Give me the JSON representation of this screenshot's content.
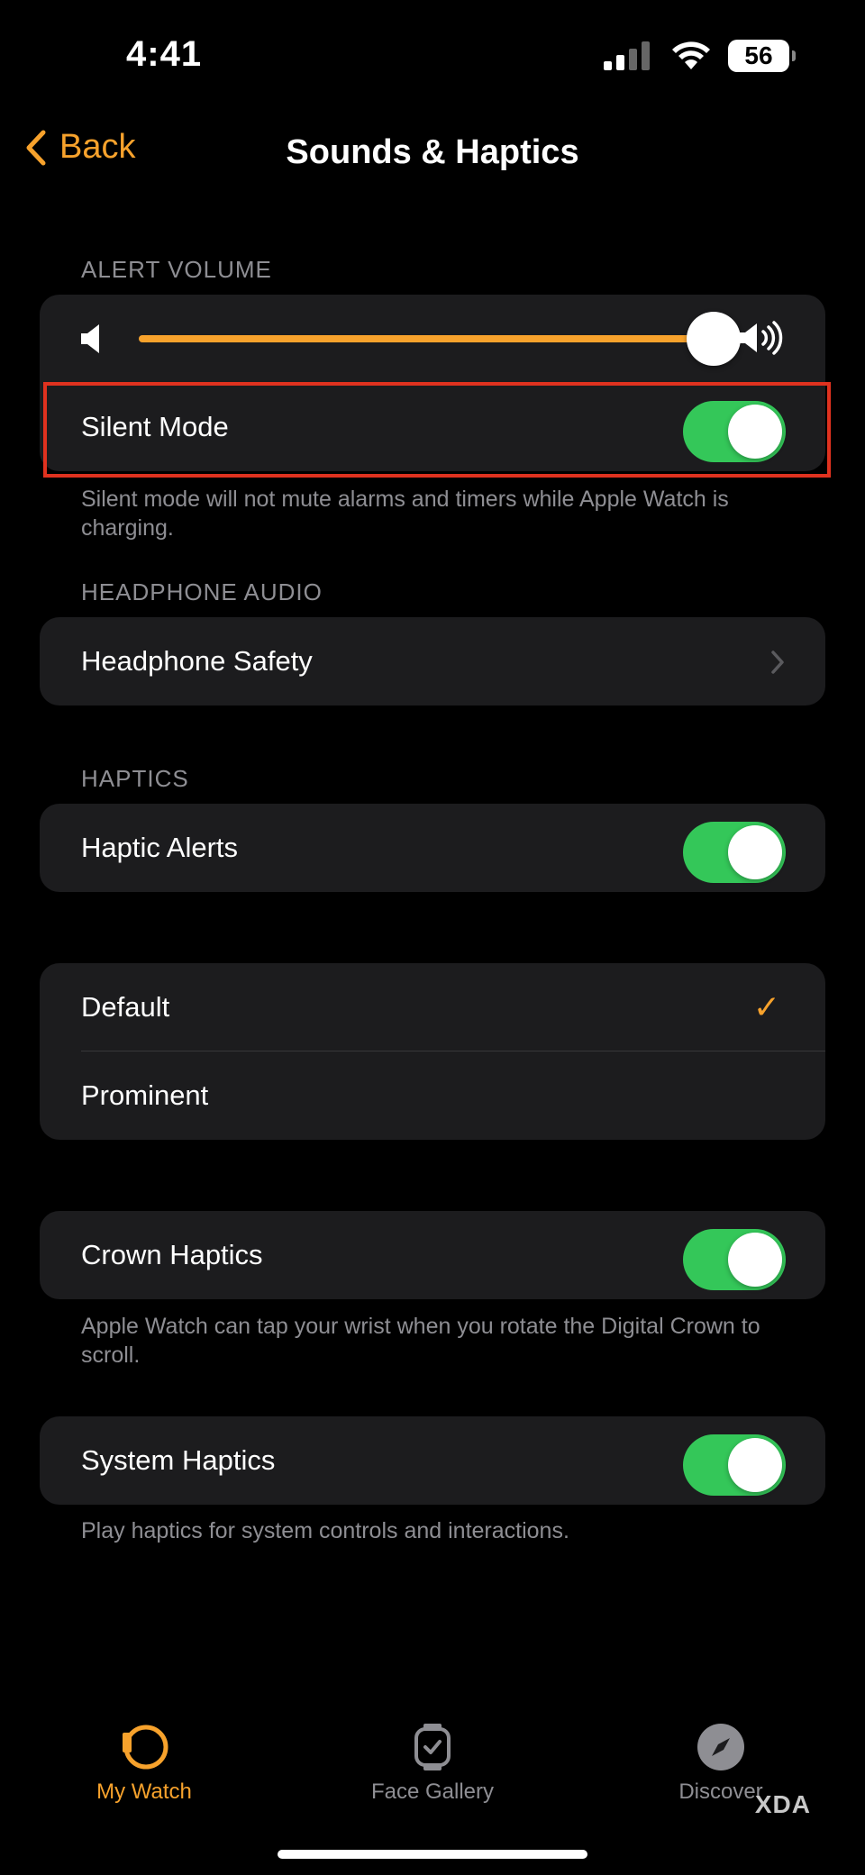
{
  "status": {
    "time": "4:41",
    "battery": "56"
  },
  "nav": {
    "back_label": "Back",
    "title": "Sounds & Haptics"
  },
  "alert_volume": {
    "header": "ALERT VOLUME",
    "level": 0.95
  },
  "silent_mode": {
    "label": "Silent Mode",
    "on": true,
    "footnote": "Silent mode will not mute alarms and timers while Apple Watch is charging."
  },
  "headphone": {
    "header": "HEADPHONE AUDIO",
    "safety_label": "Headphone Safety"
  },
  "haptics": {
    "header": "HAPTICS",
    "alerts_label": "Haptic Alerts",
    "alerts_on": true,
    "options": [
      {
        "label": "Default",
        "selected": true
      },
      {
        "label": "Prominent",
        "selected": false
      }
    ],
    "crown_label": "Crown Haptics",
    "crown_on": true,
    "crown_footnote": "Apple Watch can tap your wrist when you rotate the Digital Crown to scroll.",
    "system_label": "System Haptics",
    "system_on": true,
    "system_footnote": "Play haptics for system controls and interactions."
  },
  "tabs": [
    {
      "label": "My Watch",
      "active": true,
      "color": "#f7a22c"
    },
    {
      "label": "Face Gallery",
      "active": false,
      "color": "#8e8e93"
    },
    {
      "label": "Discover",
      "active": false,
      "color": "#8e8e93"
    }
  ],
  "watermark": "XDA",
  "colors": {
    "accent": "#f7a22c",
    "toggle_on": "#34c759",
    "highlight": "#e0321f"
  }
}
